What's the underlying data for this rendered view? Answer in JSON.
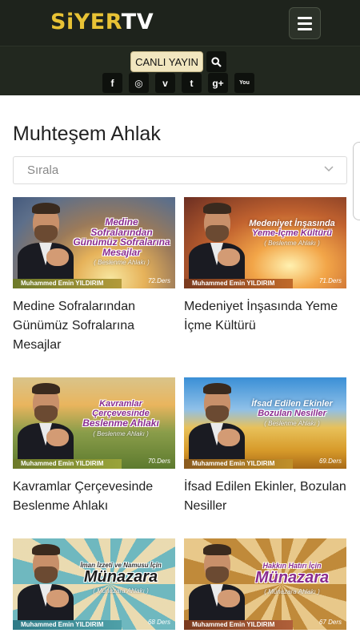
{
  "brand": {
    "logo_part1": "SiYER",
    "logo_part2": "TV"
  },
  "header": {
    "live_label": "CANLI YAYIN",
    "social_icons": [
      "facebook-icon",
      "instagram-icon",
      "vimeo-icon",
      "twitter-icon",
      "google-plus-icon",
      "youtube-icon"
    ],
    "social_glyphs": [
      "f",
      "◎",
      "v",
      "t",
      "g+",
      "You"
    ]
  },
  "main": {
    "title": "Muhteşem Ahlak",
    "sort_placeholder": "Sırala"
  },
  "colors": {
    "header_bg": "#1e231c",
    "logo_gold": "#e8c235",
    "live_button_bg": "#f1e6bf"
  },
  "videos": [
    {
      "title": "Medine Sofralarından Günümüz Sofralarına Mesajlar",
      "thumb_line1": "Medine Sofralarından",
      "thumb_line2": "Günümüz Sofralarına Mesajlar",
      "thumb_sub": "( Beslenme Ahlakı )",
      "presenter": "Muhammed Emin YILDIRIM",
      "episode": "72.Ders"
    },
    {
      "title": "Medeniyet İnşasında Yeme İçme Kültürü",
      "thumb_line1": "Medeniyet İnşasında",
      "thumb_line2": "Yeme-İçme Kültürü",
      "thumb_sub": "( Beslenme Ahlakı )",
      "presenter": "Muhammed Emin YILDIRIM",
      "episode": "71.Ders"
    },
    {
      "title": "Kavramlar Çerçevesinde Beslenme Ahlakı",
      "thumb_line1": "Kavramlar Çerçevesinde",
      "thumb_line2": "Beslenme Ahlakı",
      "thumb_sub": "( Beslenme Ahlakı )",
      "presenter": "Muhammed Emin YILDIRIM",
      "episode": "70.Ders"
    },
    {
      "title": "İfsad Edilen Ekinler, Bozulan Nesiller",
      "thumb_line1": "İfsad Edilen Ekinler",
      "thumb_line2": "Bozulan Nesiller",
      "thumb_sub": "( Beslenme Ahlakı )",
      "presenter": "Muhammed Emin YILDIRIM",
      "episode": "69.Ders"
    },
    {
      "title": "",
      "thumb_line1": "İman İzzeti ve Namusu İçin",
      "thumb_line2": "Münazara",
      "thumb_sub": "( Münazara Ahlakı )",
      "presenter": "Muhammed Emin YILDIRIM",
      "episode": "68 Ders"
    },
    {
      "title": "",
      "thumb_line1": "Hakkın Hatırı İçin",
      "thumb_line2": "Münazara",
      "thumb_sub": "( Münazara Ahlakı )",
      "presenter": "Muhammed Emin YILDIRIM",
      "episode": "67 Ders"
    }
  ]
}
